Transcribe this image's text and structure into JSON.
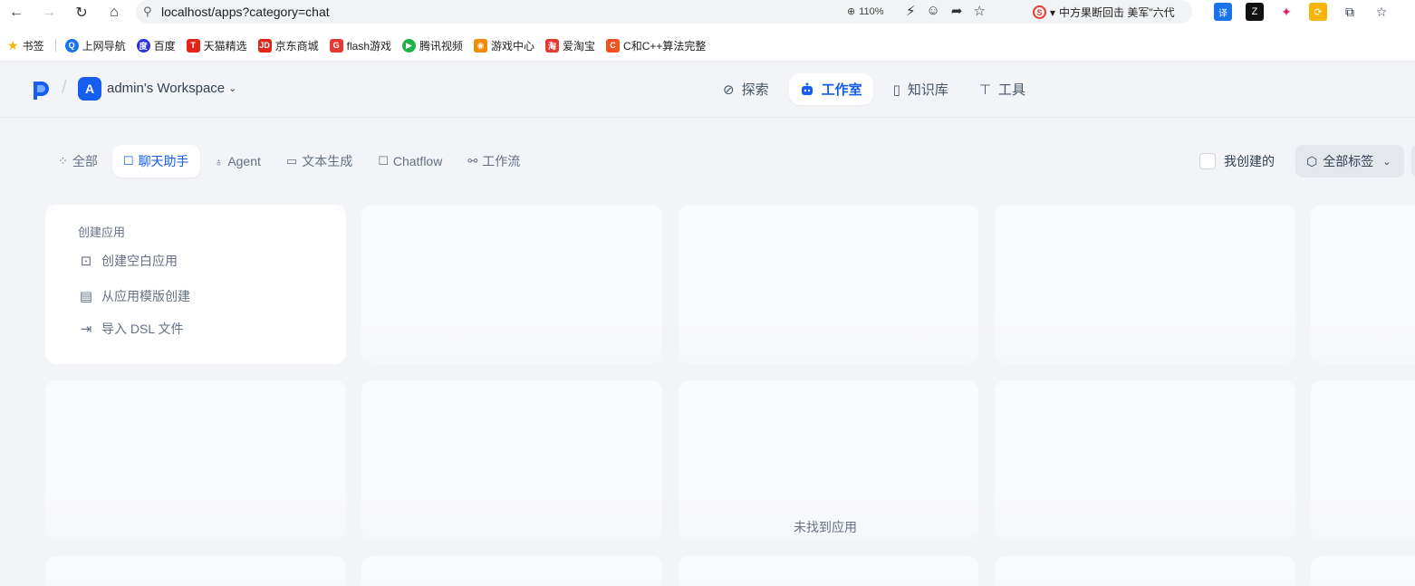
{
  "browser": {
    "url": "localhost/apps?category=chat",
    "zoom": "110%",
    "news_text": "中方果断回击 美军\"六代",
    "bookmarks": [
      {
        "label": "书签",
        "icon": "star-icon",
        "color": "#f4b400"
      },
      {
        "label": "上网导航",
        "icon": "navigation-icon",
        "color": "#1a73e8"
      },
      {
        "label": "百度",
        "icon": "baidu-icon",
        "color": "#2932e1"
      },
      {
        "label": "天猫精选",
        "icon": "tmall-icon",
        "color": "#e1251b"
      },
      {
        "label": "京东商城",
        "icon": "jd-icon",
        "color": "#e1251b"
      },
      {
        "label": "flash游戏",
        "icon": "flash-game-icon",
        "color": "#e53935"
      },
      {
        "label": "腾讯视频",
        "icon": "tencent-video-icon",
        "color": "#20b14a"
      },
      {
        "label": "游戏中心",
        "icon": "game-center-icon",
        "color": "#f28b00"
      },
      {
        "label": "爱淘宝",
        "icon": "taobao-icon",
        "color": "#e53935"
      },
      {
        "label": "C和C++算法完整",
        "icon": "c-icon",
        "color": "#f4511e"
      }
    ]
  },
  "header": {
    "workspace_initial": "A",
    "workspace_name": "admin's Workspace",
    "nav": [
      {
        "label": "探索",
        "icon": "explore-icon",
        "active": false
      },
      {
        "label": "工作室",
        "icon": "robot-icon",
        "active": true
      },
      {
        "label": "知识库",
        "icon": "book-icon",
        "active": false
      },
      {
        "label": "工具",
        "icon": "tool-icon",
        "active": false
      }
    ]
  },
  "filters": {
    "tabs": [
      {
        "label": "全部",
        "icon": "grid-icon"
      },
      {
        "label": "聊天助手",
        "icon": "chat-bot-icon"
      },
      {
        "label": "Agent",
        "icon": "agent-icon"
      },
      {
        "label": "文本生成",
        "icon": "document-icon"
      },
      {
        "label": "Chatflow",
        "icon": "chatflow-icon"
      },
      {
        "label": "工作流",
        "icon": "workflow-icon"
      }
    ],
    "active_tab": "聊天助手",
    "mine_label": "我创建的",
    "tags_label": "全部标签"
  },
  "create_card": {
    "title": "创建应用",
    "items": [
      {
        "label": "创建空白应用",
        "icon": "file-plus-icon"
      },
      {
        "label": "从应用模版创建",
        "icon": "template-icon"
      },
      {
        "label": "导入 DSL 文件",
        "icon": "import-icon"
      }
    ]
  },
  "empty_state": "未找到应用",
  "colors": {
    "accent": "#155eef",
    "background": "#f2f4f7",
    "muted_text": "#667085"
  }
}
